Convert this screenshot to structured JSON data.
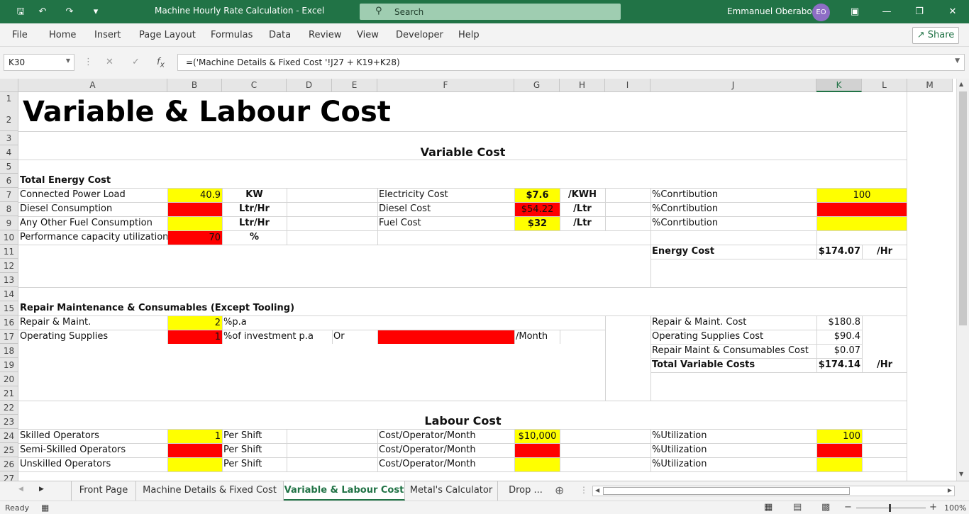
{
  "window": {
    "title": "Machine Hourly Rate Calculation  -  Excel",
    "search_placeholder": "Search",
    "user_name": "Emmanuel Oberabor",
    "user_initials": "EO"
  },
  "menu": [
    "File",
    "Home",
    "Insert",
    "Page Layout",
    "Formulas",
    "Data",
    "Review",
    "View",
    "Developer",
    "Help"
  ],
  "share_label": "Share",
  "formula_bar": {
    "name_box": "K30",
    "formula": "=('Machine Details & Fixed Cost '!J27 + K19+K28)"
  },
  "columns": [
    "A",
    "B",
    "C",
    "D",
    "E",
    "F",
    "G",
    "H",
    "I",
    "J",
    "K",
    "L",
    "M"
  ],
  "selected_column": "K",
  "rows": [
    "1",
    "2",
    "3",
    "4",
    "5",
    "6",
    "7",
    "8",
    "9",
    "10",
    "11",
    "12",
    "13",
    "14",
    "15",
    "16",
    "17",
    "18",
    "19",
    "20",
    "21",
    "22",
    "23",
    "24",
    "25",
    "26",
    "27"
  ],
  "sheet": {
    "title": "Variable & Labour Cost",
    "variable_cost_header": "Variable Cost",
    "total_energy_cost": "Total Energy Cost",
    "a7": "Connected Power Load",
    "b7": "40.9",
    "c7": "KW",
    "a8": "Diesel Consumption",
    "c8": "Ltr/Hr",
    "a9": "Any Other Fuel Consumption",
    "c9": "Ltr/Hr",
    "a10": "Performance capacity utilization",
    "b10": "70",
    "c10": "%",
    "f7": "Electricity Cost",
    "g7": "$7.6",
    "h7": "/KWH",
    "f8": "Diesel Cost",
    "g8": "$54.22",
    "h8": "/Ltr",
    "f9": "Fuel Cost",
    "g9": "$32",
    "h9": "/Ltr",
    "j7": "%Conrtibution",
    "k7": "100",
    "j8": "%Conrtibution",
    "j9": "%Conrtibution",
    "j11": "Energy Cost",
    "k11": "$174.07",
    "l11": "/Hr",
    "repair_header": "Repair Maintenance & Consumables (Except Tooling)",
    "a16": "Repair & Maint.",
    "b16": "2",
    "c16": "%p.a",
    "a17": "Operating Supplies",
    "b17": "1",
    "c17": "%of investment p.a",
    "e17": "Or",
    "g17": "/Month",
    "j16": "Repair & Maint. Cost",
    "k16": "$180.8",
    "j17": "Operating Supplies Cost",
    "k17": "$90.4",
    "j18": "Repair Maint & Consumables Cost",
    "k18": "$0.07",
    "j19": "Total Variable Costs",
    "k19": "$174.14",
    "l19": "/Hr",
    "labour_cost_header": "Labour Cost",
    "a24": "Skilled Operators",
    "b24": "1",
    "c24": "Per Shift",
    "a25": "Semi-Skilled Operators",
    "c25": "Per Shift",
    "a26": "Unskilled Operators",
    "c26": "Per Shift",
    "f24": "Cost/Operator/Month",
    "g24": "$10,000",
    "f25": "Cost/Operator/Month",
    "f26": "Cost/Operator/Month",
    "j24": "%Utilization",
    "k24": "100",
    "j25": "%Utilization",
    "j26": "%Utilization"
  },
  "tabs": [
    "Front Page",
    "Machine Details & Fixed Cost",
    "Variable & Labour Cost",
    "Metal's Calculator",
    "Drop ..."
  ],
  "active_tab": "Variable & Labour Cost",
  "status": {
    "mode": "Ready",
    "zoom": "100%"
  },
  "colors": {
    "excel_green": "#217346",
    "input_yellow": "#ffff00",
    "missing_red": "#ff0000"
  }
}
